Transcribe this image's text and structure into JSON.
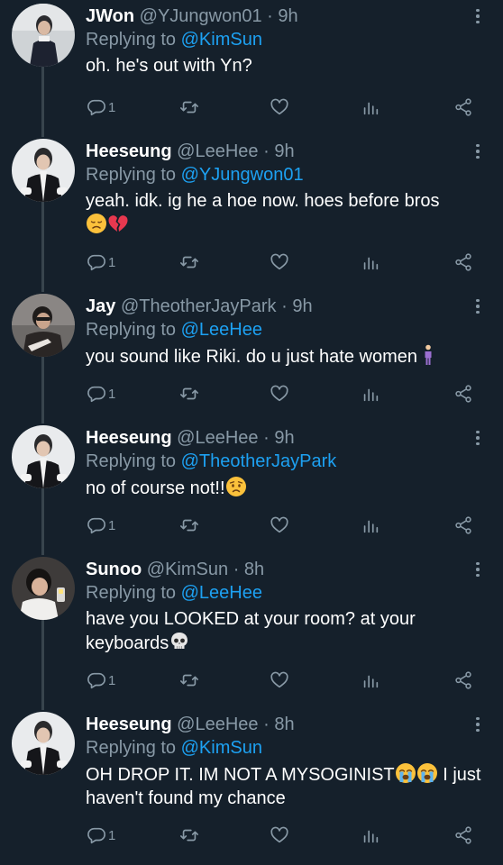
{
  "colors": {
    "background": "#15202b",
    "text": "#ffffff",
    "muted": "#8899a6",
    "accent": "#1da1f2",
    "thread_line": "#38444d"
  },
  "reply_prefix": "Replying to",
  "icons": [
    "reply-icon",
    "retweet-icon",
    "like-icon",
    "analytics-icon",
    "share-icon",
    "more-icon"
  ],
  "tweets": [
    {
      "name": "JWon",
      "handle": "@YJungwon01",
      "time": "9h",
      "replying_to": "@KimSun",
      "text": "oh. he's out with Yn?",
      "emojis": [],
      "reply_count": "1"
    },
    {
      "name": "Heeseung",
      "handle": "@LeeHee",
      "time": "9h",
      "replying_to": "@YJungwon01",
      "text": "yeah. idk. ig he a hoe now. hoes before bros",
      "emojis": [
        "disappointed-face-emoji",
        "broken-heart-emoji"
      ],
      "reply_count": "1"
    },
    {
      "name": "Jay",
      "handle": "@TheotherJayPark",
      "time": "9h",
      "replying_to": "@LeeHee",
      "text": "you sound like Riki. do u just hate women",
      "emojis": [
        "person-standing-emoji"
      ],
      "reply_count": "1"
    },
    {
      "name": "Heeseung",
      "handle": "@LeeHee",
      "time": "9h",
      "replying_to": "@TheotherJayPark",
      "text": "no of course not!!",
      "emojis": [
        "worried-face-emoji"
      ],
      "reply_count": "1"
    },
    {
      "name": "Sunoo",
      "handle": "@KimSun",
      "time": "8h",
      "replying_to": "@LeeHee",
      "text": "have you LOOKED at your room? at your keyboards",
      "emojis": [
        "skull-emoji"
      ],
      "reply_count": "1"
    },
    {
      "name": "Heeseung",
      "handle": "@LeeHee",
      "time": "8h",
      "replying_to": "@KimSun",
      "text_part1": "OH DROP IT. IM NOT A MYSOGINIST",
      "text_part2": " I just haven't found my chance",
      "emojis": [
        "loudly-crying-face-emoji",
        "loudly-crying-face-emoji"
      ],
      "reply_count": "1"
    }
  ]
}
